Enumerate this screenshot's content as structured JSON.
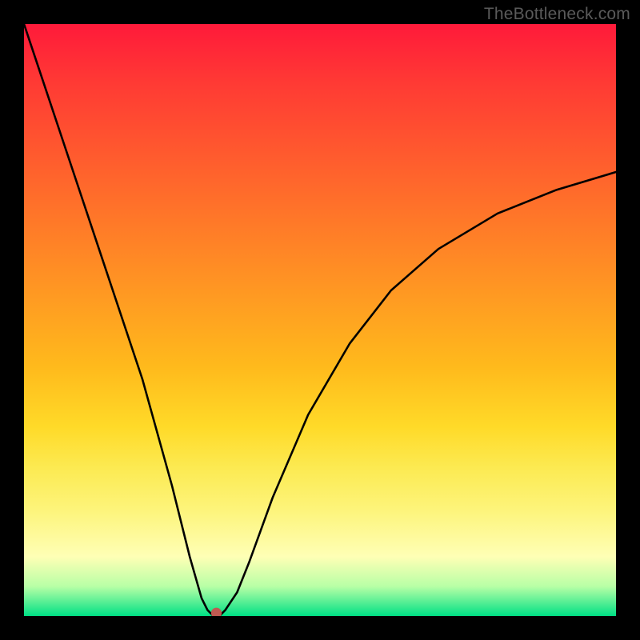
{
  "watermark": "TheBottleneck.com",
  "chart_data": {
    "type": "line",
    "title": "",
    "xlabel": "",
    "ylabel": "",
    "xlim": [
      0,
      100
    ],
    "ylim": [
      0,
      100
    ],
    "x": [
      0,
      5,
      10,
      15,
      20,
      25,
      28,
      30,
      31,
      32,
      33,
      34,
      36,
      38,
      42,
      48,
      55,
      62,
      70,
      80,
      90,
      100
    ],
    "values": [
      100,
      85,
      70,
      55,
      40,
      22,
      10,
      3,
      1,
      0,
      0,
      1,
      4,
      9,
      20,
      34,
      46,
      55,
      62,
      68,
      72,
      75
    ],
    "minimum_marker": {
      "x": 32.5,
      "y": 0.5
    },
    "curve_color": "#000000",
    "marker_color": "#c05a52"
  }
}
